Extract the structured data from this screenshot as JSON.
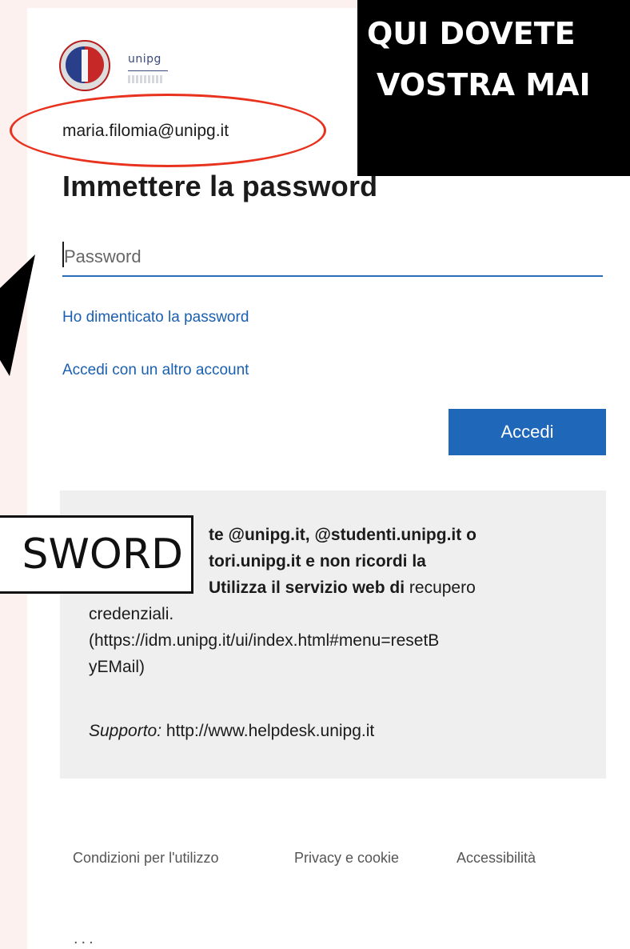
{
  "logo": {
    "brand_text": "unipg"
  },
  "account": {
    "email": "maria.filomia@unipg.it"
  },
  "form": {
    "title": "Immettere la password",
    "password_placeholder": "Password",
    "forgot_link": "Ho dimenticato la password",
    "other_account_link": "Accedi con un altro account",
    "submit_label": "Accedi"
  },
  "info": {
    "line1_bold": "te @unipg.it, @studenti.unipg.it o",
    "line2_bold": "tori.unipg.it e non ricordi la",
    "line3_bold": "Utilizza il servizio web di",
    "line3_rest": "recupero",
    "line4": "credenziali.",
    "line5": "(https://idm.unipg.it/ui/index.html#menu=resetB",
    "line6": "yEMail)",
    "support_label": "Supporto:",
    "support_url": "http://www.helpdesk.unipg.it"
  },
  "footer": {
    "terms": "Condizioni per l'utilizzo",
    "privacy": "Privacy e cookie",
    "accessibility": "Accessibilità",
    "more": "..."
  },
  "overlay": {
    "banner_line1": "QUI DOVETE",
    "banner_line2": "VOSTRA MAI",
    "callout_text": "SWORD"
  },
  "colors": {
    "accent": "#1f67b8",
    "link": "#1a5fb0",
    "highlight_circle": "#e8321e"
  }
}
